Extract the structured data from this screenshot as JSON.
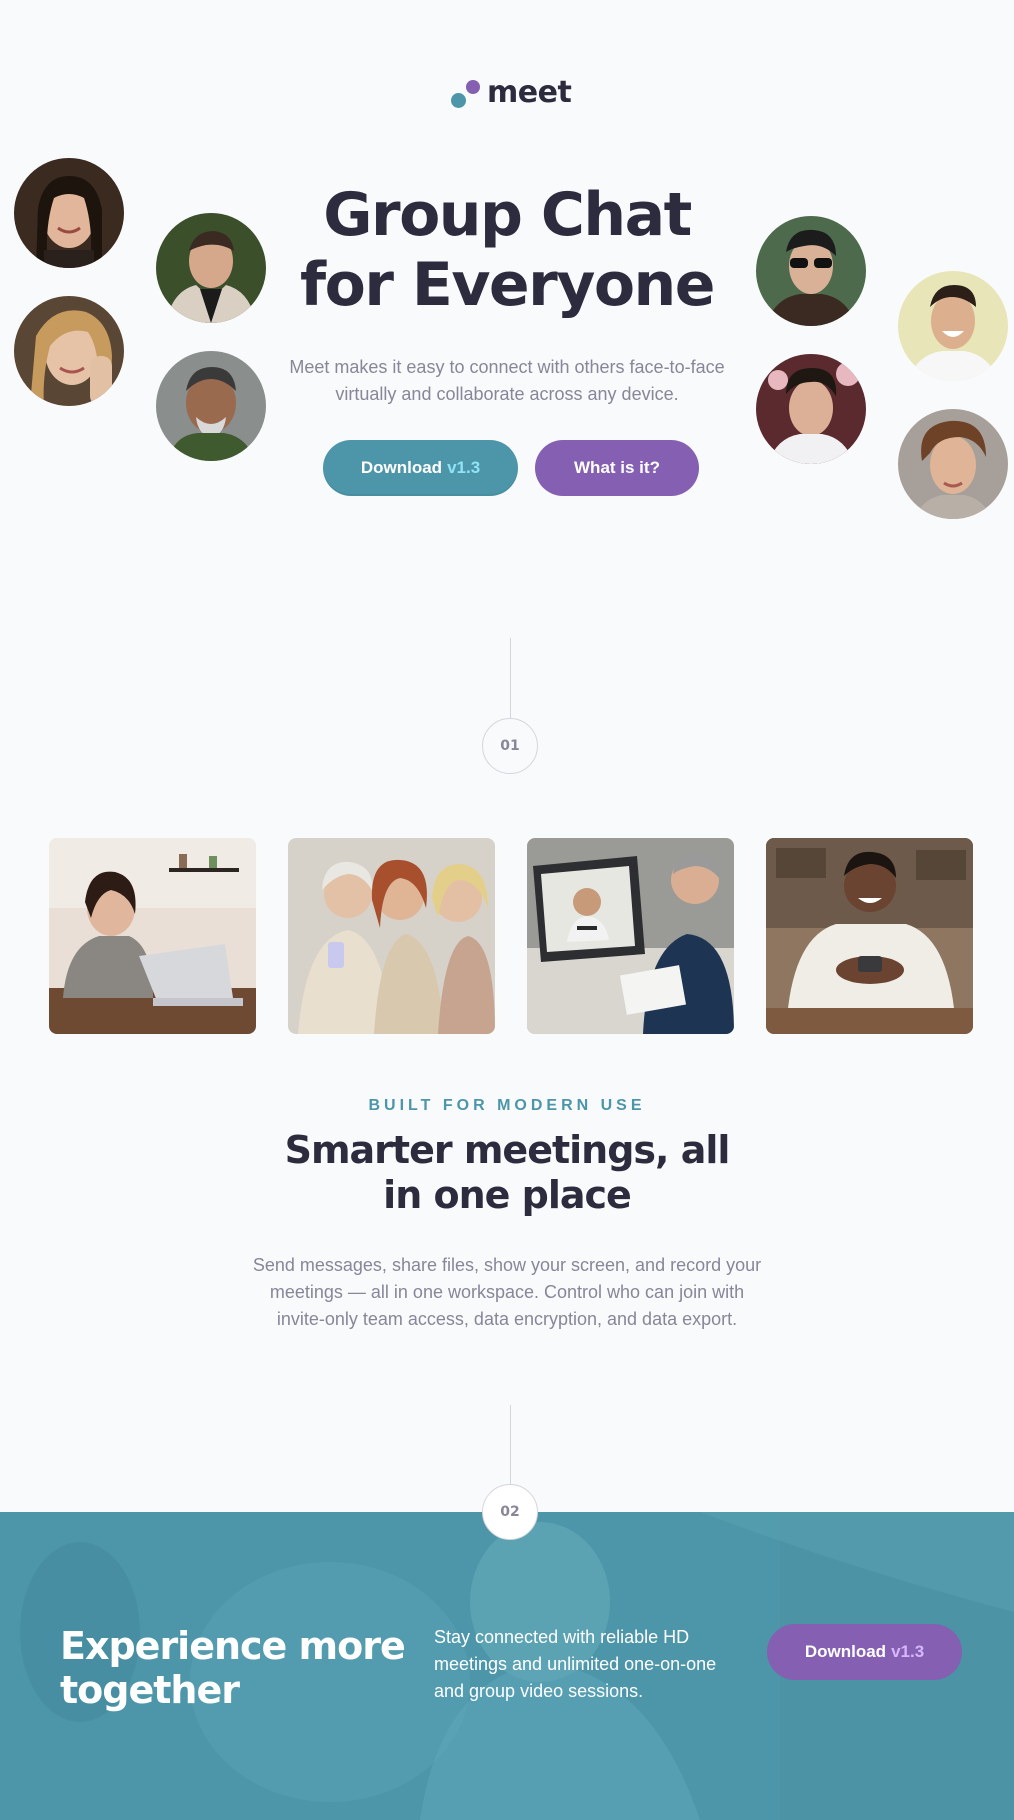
{
  "brand": {
    "name": "meet",
    "teal": "#4d96a9",
    "purple": "#855fb1",
    "dark": "#2d2c3f",
    "muted": "#87869a"
  },
  "hero": {
    "title_line1": "Group Chat",
    "title_line2": "for Everyone",
    "description": "Meet makes it easy to connect with others face-to-face virtually and collaborate across any device.",
    "download_label": "Download",
    "version": "v1.3",
    "what_label": "What is it?"
  },
  "steps": {
    "first": "01",
    "second": "02"
  },
  "features": {
    "eyebrow": "BUILT FOR MODERN USE",
    "title_line1": "Smarter meetings, all",
    "title_line2": "in one place",
    "description": "Send messages, share files, show your screen, and record your meetings — all in one workspace. Control who can join with invite-only team access, data encryption, and data export."
  },
  "cta": {
    "title_line1": "Experience more",
    "title_line2": "together",
    "description": "Stay connected with reliable HD meetings and unlimited one-on-one and group video sessions.",
    "download_label": "Download",
    "version": "v1.3"
  }
}
